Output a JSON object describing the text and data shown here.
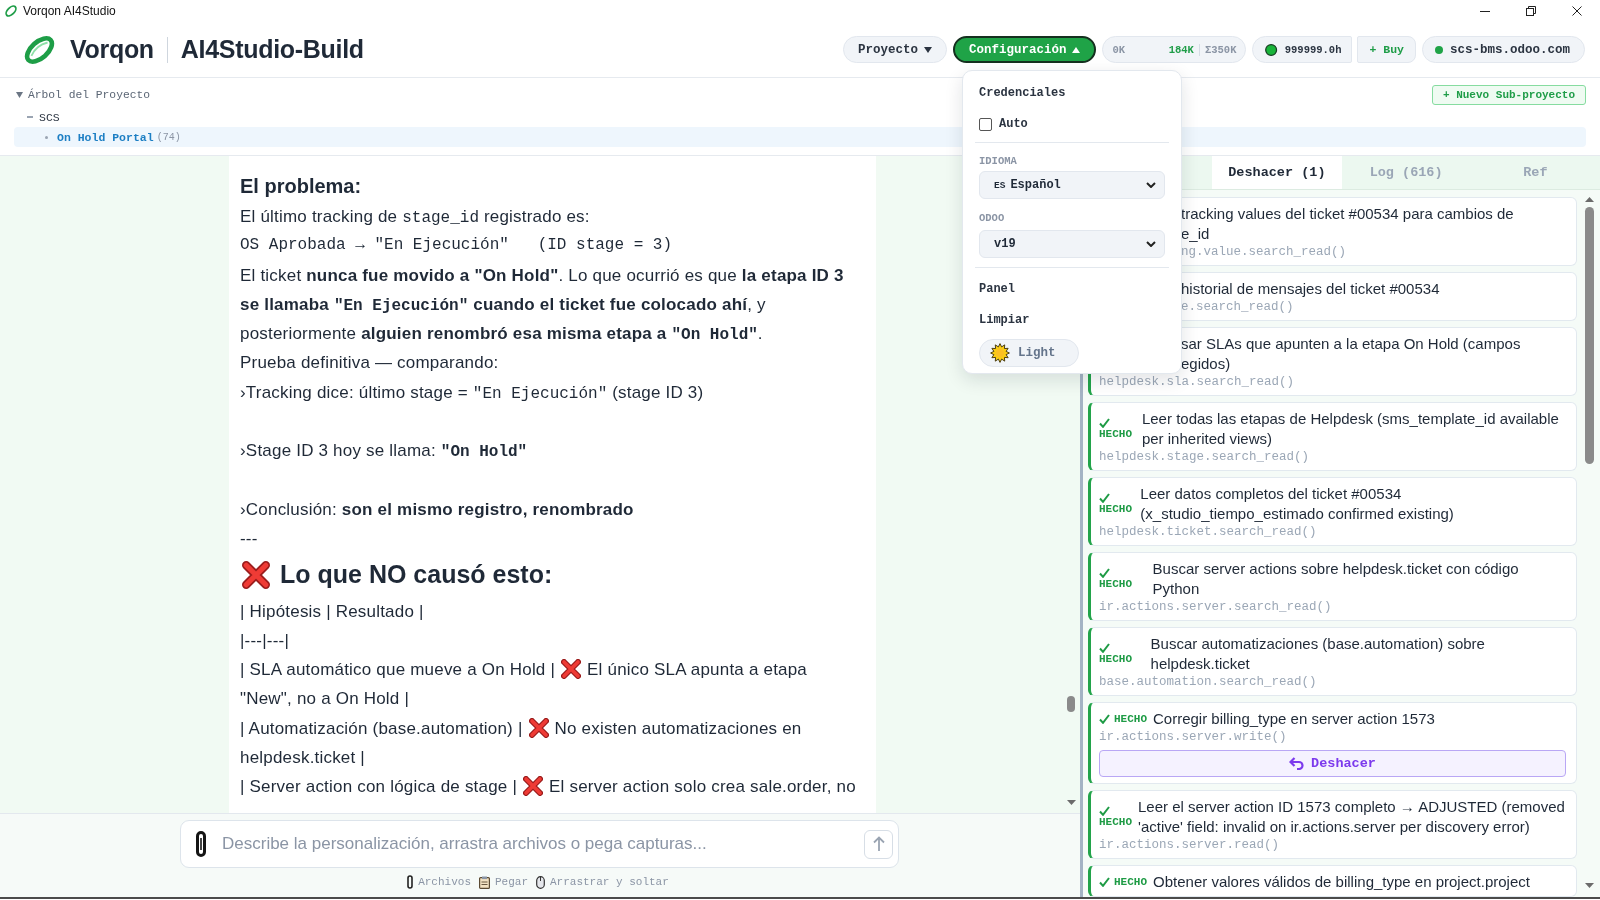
{
  "window": {
    "title": "Vorqon AI4Studio"
  },
  "header": {
    "brand": "Vorqon",
    "project_name": "AI4Studio-Build",
    "menus": [
      {
        "label": "Proyecto",
        "expanded": false
      },
      {
        "label": "Configuración",
        "expanded": true
      }
    ],
    "tokens": {
      "used": "0K",
      "session": "184K",
      "total": "Σ350K"
    },
    "credits": {
      "amount": "999999.0h",
      "buy": "+ Buy"
    },
    "connection": {
      "host": "scs-bms.odoo.com",
      "connected": true
    }
  },
  "config_menu": {
    "title": "Credenciales",
    "auto": {
      "label": "Auto",
      "checked": false
    },
    "language": {
      "label": "IDIOMA",
      "flag": "ES",
      "value": "Español"
    },
    "odoo": {
      "label": "ODOO",
      "value": "v19"
    },
    "items": [
      "Panel",
      "Limpiar"
    ],
    "theme": {
      "label": "Light"
    }
  },
  "project_tree": {
    "title": "Árbol del Proyecto",
    "expanded": true,
    "new_button": "+ Nuevo Sub-proyecto",
    "items": [
      {
        "label": "SCS",
        "selected": false,
        "children": [
          {
            "label": "On Hold Portal",
            "count": "(74)",
            "selected": true
          }
        ]
      }
    ]
  },
  "message": {
    "blocks": [
      {
        "kind": "heading",
        "segments": [
          {
            "kind": "text",
            "text": "El problema:"
          }
        ]
      },
      {
        "kind": "paragraph",
        "segments": [
          {
            "kind": "text",
            "text": "El último tracking de "
          },
          {
            "kind": "code",
            "text": "stage_id"
          },
          {
            "kind": "text",
            "text": " registrado es:"
          }
        ]
      },
      {
        "kind": "preformatted",
        "segments": [
          {
            "kind": "code",
            "text": "OS Aprobada → \"En Ejecución\"   (ID stage = 3)"
          }
        ]
      },
      {
        "kind": "paragraph",
        "segments": [
          {
            "kind": "text",
            "text": "El ticket **nunca fue movido a \"On Hold\"**. Lo que ocurrió es que **la etapa ID 3 se llamaba** "
          },
          {
            "kind": "code",
            "text": "**\"En Ejecución\"**"
          },
          {
            "kind": "text",
            "text": " **cuando el ticket fue colocado ahí**, y posteriormente **alguien renombró esa misma etapa a** "
          },
          {
            "kind": "code",
            "text": "**\"On Hold\"**"
          },
          {
            "kind": "text",
            "text": "."
          }
        ]
      },
      {
        "kind": "paragraph",
        "segments": [
          {
            "kind": "text",
            "text": "Prueba definitiva — comparando:"
          }
        ]
      },
      {
        "kind": "point",
        "segments": [
          {
            "kind": "text",
            "text": "›Tracking dice: último stage = "
          },
          {
            "kind": "code",
            "text": "\"En Ejecución\""
          },
          {
            "kind": "text",
            "text": " (stage ID 3)"
          }
        ]
      },
      {
        "kind": "point",
        "segments": [
          {
            "kind": "text",
            "text": "›Stage ID 3 hoy se llama: "
          },
          {
            "kind": "code",
            "text": "**\"On Hold\"**"
          }
        ]
      },
      {
        "kind": "point",
        "segments": [
          {
            "kind": "text",
            "text": "›Conclusión: **son el mismo registro, renombrado**"
          }
        ]
      },
      {
        "kind": "paragraph",
        "segments": [
          {
            "kind": "text",
            "text": "---"
          }
        ]
      },
      {
        "kind": "section",
        "segments": [
          {
            "kind": "cross"
          },
          {
            "kind": "text",
            "text": "Lo que NO causó esto:"
          }
        ]
      },
      {
        "kind": "paragraph",
        "segments": [
          {
            "kind": "text",
            "text": "| Hipótesis | Resultado |"
          }
        ]
      },
      {
        "kind": "paragraph",
        "segments": [
          {
            "kind": "text",
            "text": "|---|---|"
          }
        ]
      },
      {
        "kind": "paragraph",
        "segments": [
          {
            "kind": "text",
            "text": "| SLA automático que mueve a On Hold |"
          },
          {
            "kind": "cross"
          },
          {
            "kind": "text",
            "text": "El único SLA apunta a etapa"
          }
        ]
      },
      {
        "kind": "paragraph",
        "segments": [
          {
            "kind": "text",
            "text": "\"New\", no a On Hold |"
          }
        ]
      },
      {
        "kind": "paragraph",
        "segments": [
          {
            "kind": "text",
            "text": "| Automatización (base.automation) |"
          },
          {
            "kind": "cross"
          },
          {
            "kind": "text",
            "text": "No existen automatizaciones en"
          }
        ]
      },
      {
        "kind": "paragraph",
        "segments": [
          {
            "kind": "text",
            "text": "helpdesk.ticket |"
          }
        ]
      },
      {
        "kind": "paragraph",
        "segments": [
          {
            "kind": "text",
            "text": "| Server action con lógica de stage |"
          },
          {
            "kind": "cross"
          },
          {
            "kind": "text",
            "text": "El server action solo crea sale.order, no"
          }
        ]
      }
    ]
  },
  "composer": {
    "placeholder": "Describe la personalización, arrastra archivos o pega capturas...",
    "hints": [
      {
        "kind": "files",
        "label": "Archivos"
      },
      {
        "kind": "paste",
        "label": "Pegar"
      },
      {
        "kind": "drag",
        "label": "Arrastrar y soltar"
      }
    ]
  },
  "side_panel": {
    "tabs": [
      {
        "label": "Deshacer (1)",
        "selected": true
      },
      {
        "label": "Log (616)",
        "selected": false
      },
      {
        "label": "Ref",
        "selected": false
      }
    ],
    "actions": [
      {
        "title": "tracking values del ticket #00534 para cambios de\ne_id",
        "title_covered": true,
        "code": "ng.value.search_read()",
        "code_covered": true
      },
      {
        "title": "historial de mensajes del ticket #00534",
        "title_covered": true,
        "code": "e.search_read()",
        "code_covered": true
      },
      {
        "title": "sar SLAs que apunten a la etapa On Hold (campos\negidos)",
        "title_covered": true,
        "code": "helpdesk.sla.search_read()",
        "code_covered": false
      },
      {
        "status": "HECHO",
        "title": "Leer todas las etapas de Helpdesk (sms_template_id available per inherited views)",
        "title_covered": false,
        "code": "helpdesk.stage.search_read()",
        "code_covered": false
      },
      {
        "status": "HECHO",
        "title": "Leer datos completos del ticket #00534 (x_studio_tiempo_estimado confirmed existing)",
        "title_covered": false,
        "code": "helpdesk.ticket.search_read()",
        "code_covered": false
      },
      {
        "status": "HECHO",
        "title": "Buscar server actions sobre helpdesk.ticket con código Python",
        "title_covered": false,
        "code": "ir.actions.server.search_read()",
        "code_covered": false
      },
      {
        "status": "HECHO",
        "title": "Buscar automatizaciones (base.automation) sobre helpdesk.ticket",
        "title_covered": false,
        "code": "base.automation.search_read()",
        "code_covered": false
      },
      {
        "status": "HECHO",
        "title": "Corregir billing_type en server action 1573",
        "title_covered": false,
        "code": "ir.actions.server.write()",
        "code_covered": false,
        "undo": "Deshacer"
      },
      {
        "status": "HECHO",
        "title": "Leer el server action ID 1573 completo → ADJUSTED (removed 'active' field: invalid on ir.actions.server per discovery error)",
        "title_covered": false,
        "code": "ir.actions.server.read()",
        "code_covered": false
      },
      {
        "status": "HECHO",
        "title": "Obtener valores válidos de billing_type en project.project",
        "title_covered": false
      }
    ]
  }
}
